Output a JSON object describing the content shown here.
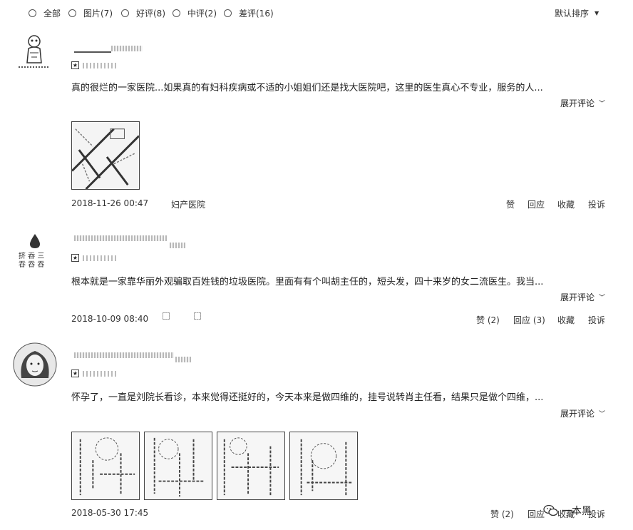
{
  "filters": [
    {
      "label": "全部"
    },
    {
      "label": "图片(7)"
    },
    {
      "label": "好评(8)"
    },
    {
      "label": "中评(2)"
    },
    {
      "label": "差评(16)"
    }
  ],
  "sort": {
    "label": "默认排序"
  },
  "reviews": [
    {
      "content": "真的很烂的一家医院...如果真的有妇科疾病或不适的小姐姐们还是找大医院吧，这里的医生真心不专业，服务的人...",
      "expand": "展开评论",
      "date": "2018-11-26 00:47",
      "tag": "妇产医院",
      "actions": {
        "like": "赞",
        "reply": "回应",
        "fav": "收藏",
        "report": "投诉"
      }
    },
    {
      "content": "根本就是一家靠华丽外观骗取百姓钱的垃圾医院。里面有有个叫胡主任的，短头发，四十来岁的女二流医生。我当...",
      "expand": "展开评论",
      "date": "2018-10-09 08:40",
      "actions": {
        "like": "赞 (2)",
        "reply": "回应 (3)",
        "fav": "收藏",
        "report": "投诉"
      }
    },
    {
      "content": "怀孕了，一直是刘院长看诊，本来觉得还挺好的，今天本来是做四维的，挂号说转肖主任看，结果只是做个四维，...",
      "expand": "展开评论",
      "date": "2018-05-30 17:45",
      "actions": {
        "like": "赞 (2)",
        "reply": "回应",
        "fav": "收藏",
        "report": "投诉"
      }
    }
  ],
  "watermark": "一本黑"
}
